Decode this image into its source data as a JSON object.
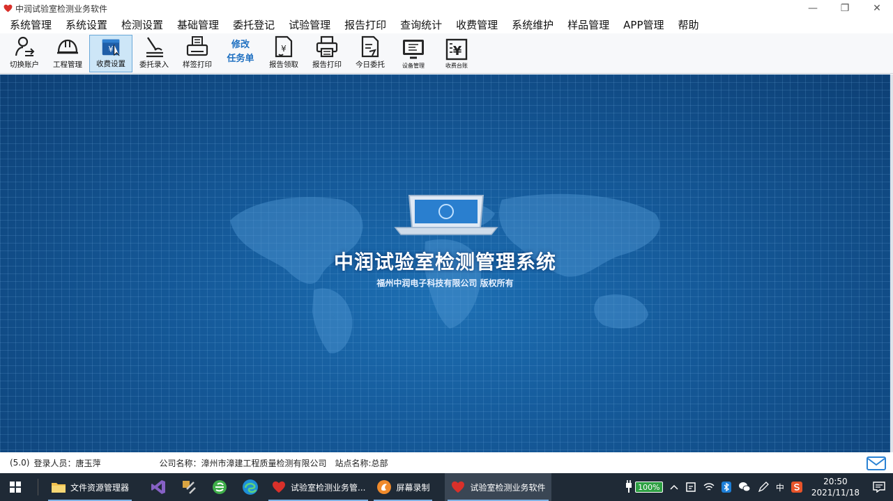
{
  "window": {
    "title": "中润试验室检测业务软件",
    "controls": {
      "minimize": "—",
      "restore": "❐",
      "close": "✕"
    }
  },
  "menu": [
    "系统管理",
    "系统设置",
    "检测设置",
    "基础管理",
    "委托登记",
    "试验管理",
    "报告打印",
    "查询统计",
    "收费管理",
    "系统维护",
    "样品管理",
    "APP管理",
    "帮助"
  ],
  "toolbar": {
    "switch_account": "切换账户",
    "project_manage": "工程管理",
    "fee_settings": "收费设置",
    "commission_entry": "委托录入",
    "label_print": "样签打印",
    "modify_line1": "修改",
    "modify_line2": "任务单",
    "report_collect": "报告领取",
    "report_print": "报告打印",
    "today_commission": "今日委托",
    "device_manage": "设备管理",
    "fee_ledger": "收费台账"
  },
  "splash": {
    "title": "中润试验室检测管理系统",
    "subtitle": "福州中润电子科技有限公司 版权所有"
  },
  "status": {
    "version": "(5.0)",
    "user": "登录人员：唐玉萍",
    "company": "公司名称：漳州市漳建工程质量检测有限公司",
    "site": "站点名称:总部"
  },
  "taskbar": {
    "file_explorer": "文件资源管理器",
    "app1": "试验室检测业务管...",
    "screen_record": "屏幕录制",
    "app2": "试验室检测业务软件",
    "battery": "100%",
    "ime": "中",
    "time": "20:50",
    "date": "2021/11/18"
  },
  "colors": {
    "accent": "#1f70c1",
    "main_bg": "#155a9a",
    "taskbar_bg": "#1f2a36"
  }
}
